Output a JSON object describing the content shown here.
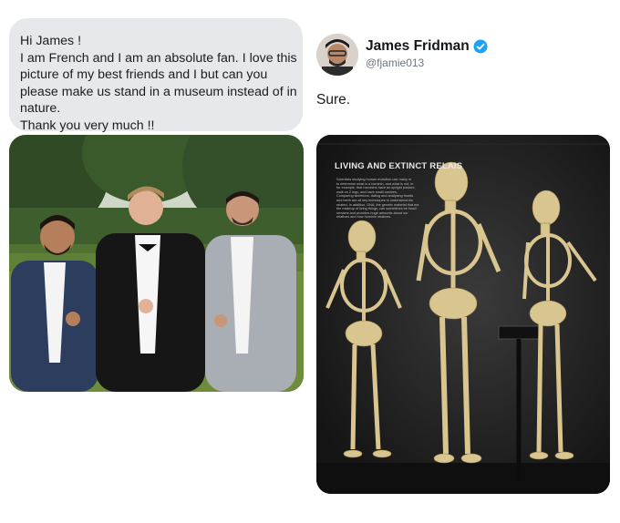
{
  "request": {
    "lines": [
      "Hi James !",
      "I am French and I am an absolute fan. I love this",
      "picture of my best friends and I but can you",
      "please make us stand in a museum instead of in",
      "nature.",
      "Thank you very much !!"
    ]
  },
  "reply": {
    "author_name": "James Fridman",
    "author_handle": "@fjamie013",
    "text": "Sure."
  },
  "museum": {
    "panel_title": "LIVING AND EXTINCT RELAIS",
    "panel_text": [
      "Scientists studying human evolution use many m",
      "to determine what is a hominin, and what is not. In",
      "for example, that hominins have an upright posture,",
      "walk on 2 legs, and have small canines.",
      "",
      "Comparing skeletons, dating and analysing fossils",
      "and teeth are all key techniques to understand his",
      "related. In addition, DNA, the genetic material that ma",
      "the makeup of living things, can sometimes be fossil",
      "remains and provides huge amounts about our",
      "relatives and how hominin relatives."
    ]
  },
  "colors": {
    "bubble": "#e6e8eb",
    "verified": "#1da1f2",
    "handle": "#6b7681",
    "museum_bg": "#1b1b1b",
    "bone": "#d9c58f"
  },
  "icons": {
    "verified": "verified-badge-icon"
  }
}
